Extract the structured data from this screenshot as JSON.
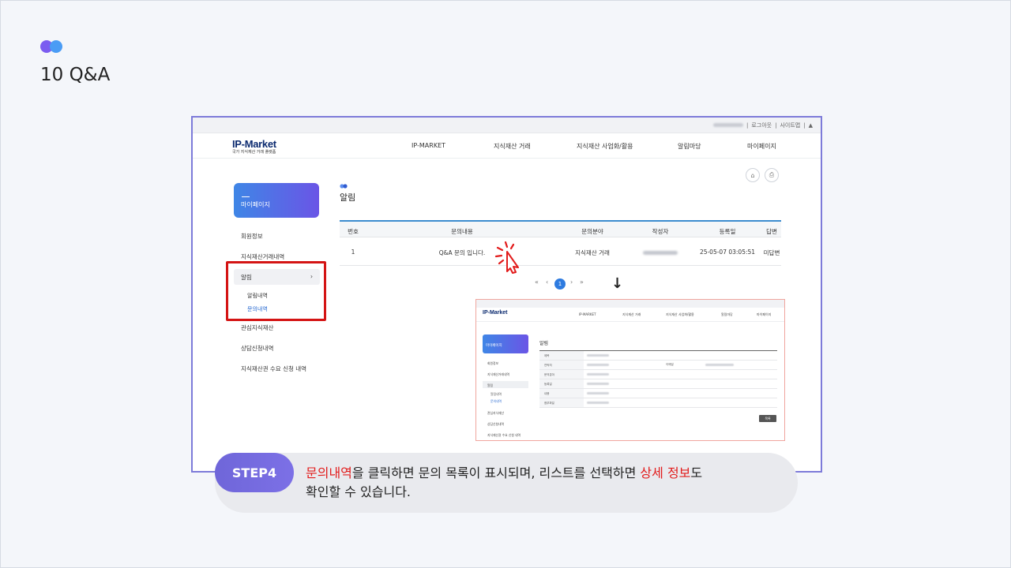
{
  "slide": {
    "title": "10 Q&A"
  },
  "site": {
    "topbar": {
      "logout": "로그아웃",
      "sitemap": "사이트맵",
      "separator": "|"
    },
    "logo": {
      "main": "IP-Market",
      "sub": "국가 지식재산 거래 플랫폼"
    },
    "nav": [
      "IP-MARKET",
      "지식재산 거래",
      "지식재산 사업화/활용",
      "알림마당",
      "마이페이지"
    ]
  },
  "sidebar": {
    "card_label": "마이페이지",
    "items": [
      "회원정보",
      "지식재산거래내역",
      "알림",
      "관심지식재산",
      "상담신청내역",
      "지식재산권 수요 신청 내역"
    ],
    "active_chevron": "›",
    "subitems": [
      "알림내역",
      "문의내역"
    ]
  },
  "content": {
    "section_title": "알림",
    "table": {
      "headers": [
        "번호",
        "문의내용",
        "문의분야",
        "작성자",
        "등록일",
        "답변"
      ],
      "rows": [
        {
          "no": "1",
          "content": "Q&A 문의 입니다.",
          "field": "지식재산 거래",
          "date": "25-05-07 03:05:51",
          "answer": "미답변"
        }
      ]
    },
    "pager": {
      "first": "«",
      "prev": "‹",
      "current": "1",
      "next": "›",
      "last": "»"
    },
    "arrow": "↓"
  },
  "inset": {
    "logo": "IP-Market",
    "nav": [
      "IP-MARKET",
      "지식재산 거래",
      "지식재산 사업화/활용",
      "알림마당",
      "마이페이지"
    ],
    "card_label": "마이페이지",
    "sidebar": [
      "회원정보",
      "지식재산거래내역",
      "알림",
      "관심지식재산",
      "상담신청내역",
      "지식재산권 수요 신청 내역"
    ],
    "subitems": [
      "알림내역",
      "문의내역"
    ],
    "title": "알림",
    "fields": [
      "제목",
      "연락처",
      "문의분야",
      "등록일",
      "내용",
      "첨부파일"
    ],
    "email_label": "이메일",
    "button": "목록"
  },
  "step": {
    "badge": "STEP4",
    "line1_hl1": "문의내역",
    "line1_mid": "을 클릭하면 문의 목록이 표시되며, 리스트를 선택하면 ",
    "line1_hl2": "상세 정보",
    "line1_end": "도",
    "line2": "확인할 수 있습니다."
  },
  "colors": {
    "accent": "#6f66d9",
    "highlight": "#e21b1b",
    "table_top": "#3c8ccf"
  }
}
